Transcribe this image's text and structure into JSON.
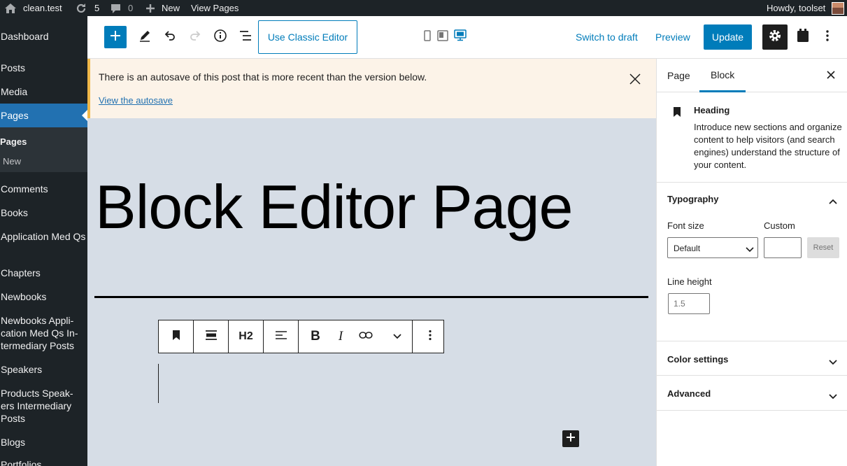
{
  "adminbar": {
    "site_name": "clean.test",
    "updates_count": "5",
    "comments_count": "0",
    "new_label": "New",
    "view_label": "View Pages",
    "greeting": "Howdy, toolset"
  },
  "sidebar": {
    "items": [
      {
        "label": "Dashboard"
      },
      {
        "label": "Posts"
      },
      {
        "label": "Media"
      },
      {
        "label": "Pages"
      },
      {
        "label": "Comments"
      },
      {
        "label": "Books"
      },
      {
        "label": "Application Med Qs"
      },
      {
        "label": "Chapters"
      },
      {
        "label": "Newbooks"
      },
      {
        "label": "Newbooks Appli-cation Med Qs In-termediary Posts"
      },
      {
        "label": "Speakers"
      },
      {
        "label": "Products Speak-ers Intermediary Posts"
      },
      {
        "label": "Blogs"
      },
      {
        "label": "Portfolios"
      }
    ],
    "submenu": [
      {
        "label": "Pages"
      },
      {
        "label": "New"
      }
    ]
  },
  "toolbar": {
    "classic_editor_label": "Use Classic Editor",
    "switch_draft_label": "Switch to draft",
    "preview_label": "Preview",
    "update_label": "Update",
    "accent_color": "#007cba"
  },
  "notice": {
    "message": "There is an autosave of this post that is more recent than the version below.",
    "link_text": "View the autosave",
    "accent_color": "#f0b849"
  },
  "editor": {
    "title": "Block Editor Page",
    "heading_level_label": "H2"
  },
  "settings_panel": {
    "tabs": [
      {
        "label": "Page",
        "active": false
      },
      {
        "label": "Block",
        "active": true
      }
    ],
    "block": {
      "name": "Heading",
      "icon": "bookmark-icon",
      "description": "Introduce new sections and organize content to help visitors (and search engines) understand the structure of your content."
    },
    "typography": {
      "title": "Typography",
      "font_size_label": "Font size",
      "font_size_value": "Default",
      "custom_label": "Custom",
      "custom_value": "",
      "reset_label": "Reset",
      "line_height_label": "Line height",
      "line_height_placeholder": "1.5"
    },
    "color_settings_title": "Color settings",
    "advanced_title": "Advanced"
  }
}
